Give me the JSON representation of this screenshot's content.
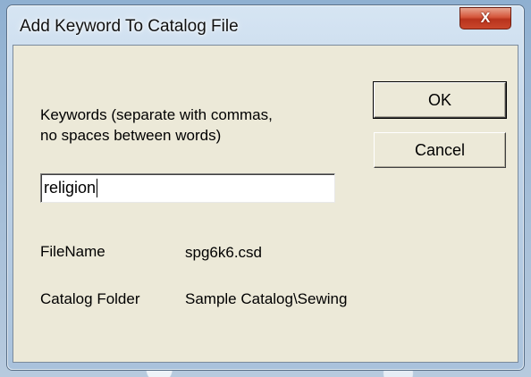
{
  "window": {
    "title": "Add Keyword To Catalog File",
    "close_label": "X"
  },
  "form": {
    "keywords_label_line1": "Keywords (separate with commas,",
    "keywords_label_line2": "no spaces between words)",
    "keywords_value": "religion",
    "filename_label": "FileName",
    "filename_value": "spg6k6.csd",
    "catalog_folder_label": "Catalog Folder",
    "catalog_folder_value": "Sample Catalog\\Sewing"
  },
  "buttons": {
    "ok_label": "OK",
    "cancel_label": "Cancel"
  }
}
